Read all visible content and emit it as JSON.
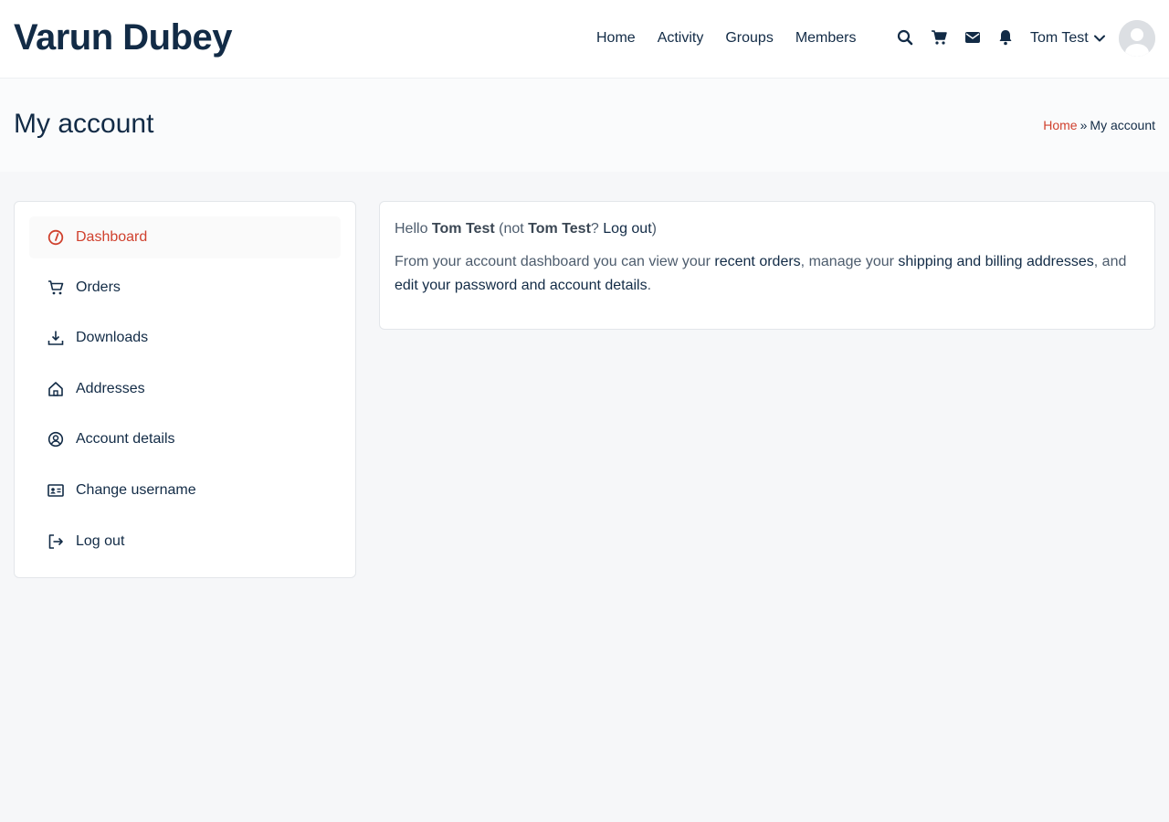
{
  "site": {
    "title": "Varun Dubey"
  },
  "nav": {
    "items": [
      "Home",
      "Activity",
      "Groups",
      "Members"
    ]
  },
  "header_icons": [
    "search-icon",
    "cart-icon",
    "envelope-icon",
    "bell-icon"
  ],
  "user": {
    "name": "Tom Test"
  },
  "page": {
    "title": "My account"
  },
  "breadcrumb": {
    "home": "Home",
    "separator": "»",
    "current": "My account"
  },
  "sidebar": {
    "items": [
      {
        "label": "Dashboard",
        "icon": "dashboard-icon",
        "active": true
      },
      {
        "label": "Orders",
        "icon": "cart-icon",
        "active": false
      },
      {
        "label": "Downloads",
        "icon": "download-icon",
        "active": false
      },
      {
        "label": "Addresses",
        "icon": "home-icon",
        "active": false
      },
      {
        "label": "Account details",
        "icon": "user-circle-icon",
        "active": false
      },
      {
        "label": "Change username",
        "icon": "id-card-icon",
        "active": false
      },
      {
        "label": "Log out",
        "icon": "logout-icon",
        "active": false
      }
    ]
  },
  "dashboard": {
    "hello": "Hello",
    "username": "Tom Test",
    "not_prefix": "(not",
    "not_username": "Tom Test",
    "question": "?",
    "logout_link": "Log out",
    "close_paren": ")",
    "intro": "From your account dashboard you can view your",
    "recent_orders_link": "recent orders",
    "mid": ", manage your",
    "addresses_link": "shipping and billing addresses",
    "and": ", and",
    "account_link": "edit your password and account details",
    "end": "."
  },
  "colors": {
    "accent": "#d0412e",
    "text": "#122b46",
    "background": "#f6f7f9"
  }
}
